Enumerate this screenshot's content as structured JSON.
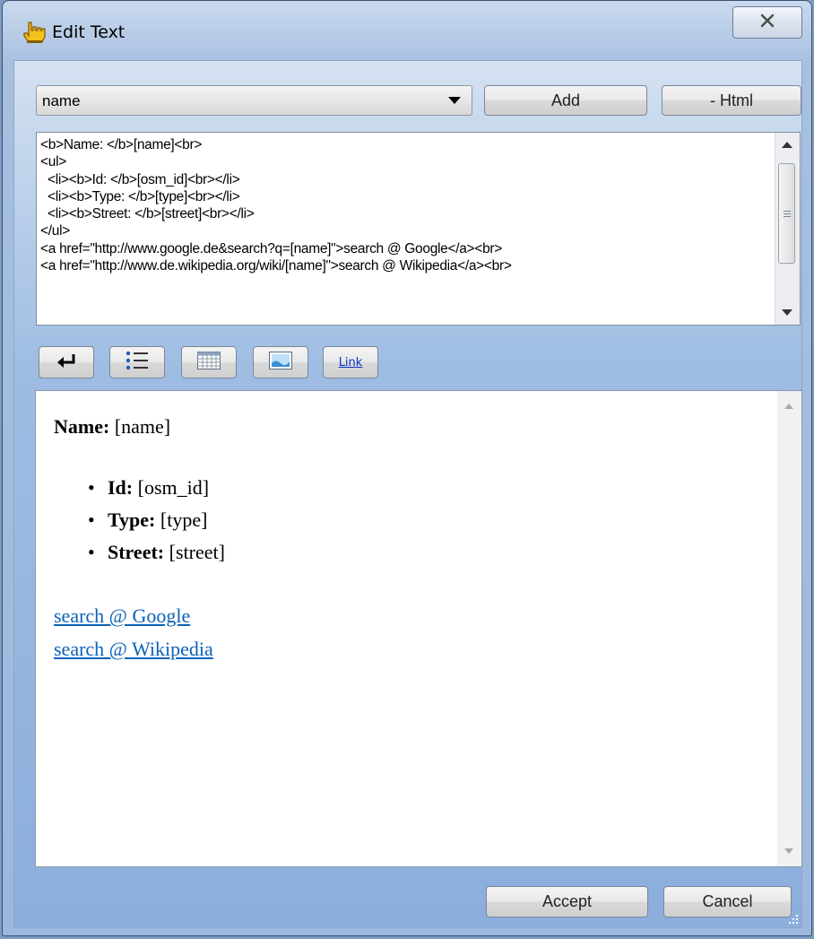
{
  "window": {
    "title": "Edit Text",
    "close_icon": "close-x-icon",
    "app_icon": "hand-pointer-icon"
  },
  "field_select": {
    "selected": "name"
  },
  "buttons": {
    "add": "Add",
    "html": "- Html",
    "accept": "Accept",
    "cancel": "Cancel"
  },
  "code_lines": [
    "<b>Name: </b>[name]<br>",
    "<ul>",
    "  <li><b>Id: </b>[osm_id]<br></li>",
    "  <li><b>Type: </b>[type]<br></li>",
    "  <li><b>Street: </b>[street]<br></li>",
    "</ul>",
    "<a href=\"http://www.google.de&search?q=[name]\">search @ Google</a><br>",
    "<a href=\"http://www.de.wikipedia.org/wiki/[name]\">search @ Wikipedia</a><br>"
  ],
  "toolbar": {
    "link_label": "Link",
    "icons": [
      "line-break-icon",
      "bullet-list-icon",
      "table-icon",
      "image-icon"
    ]
  },
  "preview": {
    "name_label": "Name:",
    "name_value": "[name]",
    "items": [
      {
        "label": "Id:",
        "value": "[osm_id]"
      },
      {
        "label": "Type:",
        "value": "[type]"
      },
      {
        "label": "Street:",
        "value": "[street]"
      }
    ],
    "links": [
      "search @ Google",
      "search @ Wikipedia"
    ]
  },
  "colors": {
    "link": "#0b62b7",
    "accent": "#9cb8dd"
  }
}
